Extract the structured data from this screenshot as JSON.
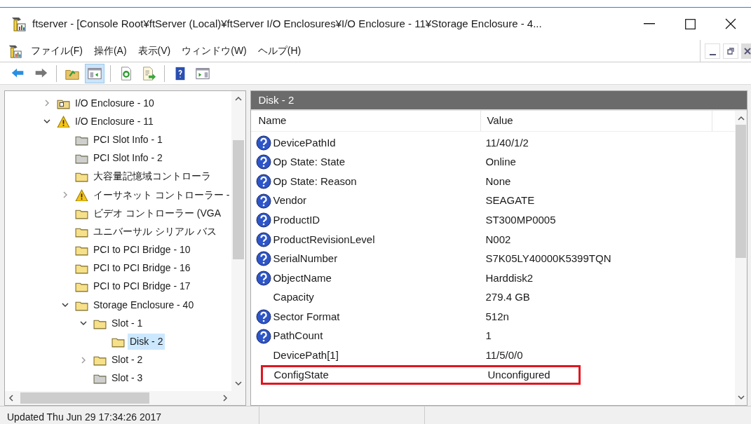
{
  "window": {
    "title": "ftserver - [Console Root¥ftServer (Local)¥ftServer I/O Enclosures¥I/O Enclosure - 11¥Storage Enclosure - 4..."
  },
  "menu": [
    "ファイル(F)",
    "操作(A)",
    "表示(V)",
    "ウィンドウ(W)",
    "ヘルプ(H)"
  ],
  "toolbar": [
    {
      "kind": "back",
      "selected": false
    },
    {
      "kind": "forward",
      "selected": false
    },
    {
      "kind": "sep"
    },
    {
      "kind": "up",
      "selected": false
    },
    {
      "kind": "tree",
      "selected": true
    },
    {
      "kind": "sep"
    },
    {
      "kind": "refresh",
      "selected": false
    },
    {
      "kind": "export",
      "selected": false
    },
    {
      "kind": "sep"
    },
    {
      "kind": "help",
      "selected": false
    },
    {
      "kind": "pane",
      "selected": false
    }
  ],
  "tree": [
    {
      "label": "I/O Enclosure - 10",
      "kind": "enclosure",
      "expanded": false,
      "selected": false
    },
    {
      "label": "I/O Enclosure - 11",
      "kind": "warning",
      "expanded": true,
      "selected": false,
      "children": [
        {
          "label": "PCI Slot Info - 1",
          "kind": "gray",
          "selected": false
        },
        {
          "label": "PCI Slot Info - 2",
          "kind": "gray",
          "selected": false
        },
        {
          "label": "大容量記憶域コントローラ",
          "kind": "folder",
          "selected": false
        },
        {
          "label": "イーサネット コントローラー -",
          "kind": "warning",
          "expanded": false,
          "selected": false
        },
        {
          "label": "ビデオ コントローラー (VGA",
          "kind": "folder",
          "selected": false
        },
        {
          "label": "ユニバーサル シリアル バス",
          "kind": "folder",
          "selected": false
        },
        {
          "label": "PCI to PCI Bridge - 10",
          "kind": "folder",
          "selected": false
        },
        {
          "label": "PCI to PCI Bridge - 16",
          "kind": "folder",
          "selected": false
        },
        {
          "label": "PCI to PCI Bridge - 17",
          "kind": "folder",
          "selected": false
        },
        {
          "label": "Storage Enclosure - 40",
          "kind": "folder",
          "expanded": true,
          "selected": false,
          "children": [
            {
              "label": "Slot - 1",
              "kind": "folder",
              "expanded": true,
              "selected": false,
              "children": [
                {
                  "label": "Disk - 2",
                  "kind": "folder",
                  "selected": true
                }
              ]
            },
            {
              "label": "Slot - 2",
              "kind": "folder",
              "expanded": false,
              "selected": false
            },
            {
              "label": "Slot - 3",
              "kind": "gray",
              "selected": false
            }
          ]
        }
      ]
    }
  ],
  "detail": {
    "title": "Disk - 2",
    "columns": [
      "Name",
      "Value"
    ],
    "rows": [
      {
        "name": "DevicePathId",
        "value": "11/40/1/2",
        "has_icon": true,
        "highlighted": false
      },
      {
        "name": "Op State: State",
        "value": "Online",
        "has_icon": true,
        "highlighted": false
      },
      {
        "name": "Op State: Reason",
        "value": "None",
        "has_icon": true,
        "highlighted": false
      },
      {
        "name": "Vendor",
        "value": "SEAGATE",
        "has_icon": true,
        "highlighted": false
      },
      {
        "name": "ProductID",
        "value": "ST300MP0005",
        "has_icon": true,
        "highlighted": false
      },
      {
        "name": "ProductRevisionLevel",
        "value": "N002",
        "has_icon": true,
        "highlighted": false
      },
      {
        "name": "SerialNumber",
        "value": "S7K05LY40000K5399TQN",
        "has_icon": true,
        "highlighted": false
      },
      {
        "name": "ObjectName",
        "value": "Harddisk2",
        "has_icon": true,
        "highlighted": false
      },
      {
        "name": "Capacity",
        "value": "279.4 GB",
        "has_icon": false,
        "highlighted": false
      },
      {
        "name": "Sector Format",
        "value": "512n",
        "has_icon": true,
        "highlighted": false
      },
      {
        "name": "PathCount",
        "value": "1",
        "has_icon": true,
        "highlighted": false
      },
      {
        "name": "DevicePath[1]",
        "value": "11/5/0/0",
        "has_icon": false,
        "highlighted": false
      },
      {
        "name": "ConfigState",
        "value": "Unconfigured",
        "has_icon": false,
        "highlighted": true
      }
    ]
  },
  "status_bar": {
    "text": "Updated Thu Jun 29 17:34:26 2017"
  }
}
